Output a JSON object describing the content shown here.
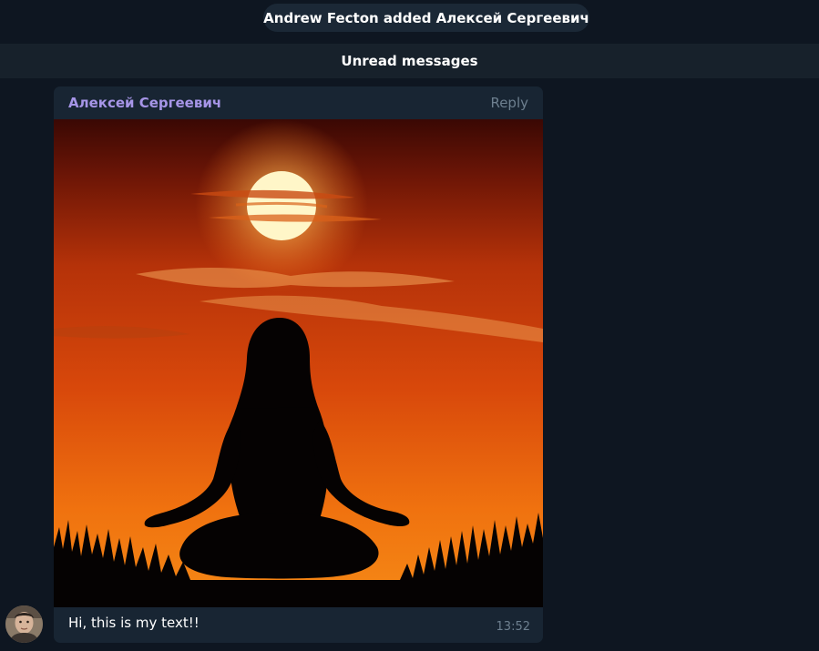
{
  "service_message": "Andrew Fecton added Алексей Сергеевич",
  "unread_label": "Unread messages",
  "message": {
    "sender": "Алексей Сергеевич",
    "reply_label": "Reply",
    "caption": "Hi, this is my text!!",
    "time": "13:52",
    "photo_icon": "sunset-meditation-photo",
    "avatar_icon": "user-avatar-photo"
  },
  "colors": {
    "background": "#0e1621",
    "bubble": "#182533",
    "sender_name": "#a695e7",
    "muted": "#6d7f8f",
    "unread_bar": "#17212b"
  }
}
